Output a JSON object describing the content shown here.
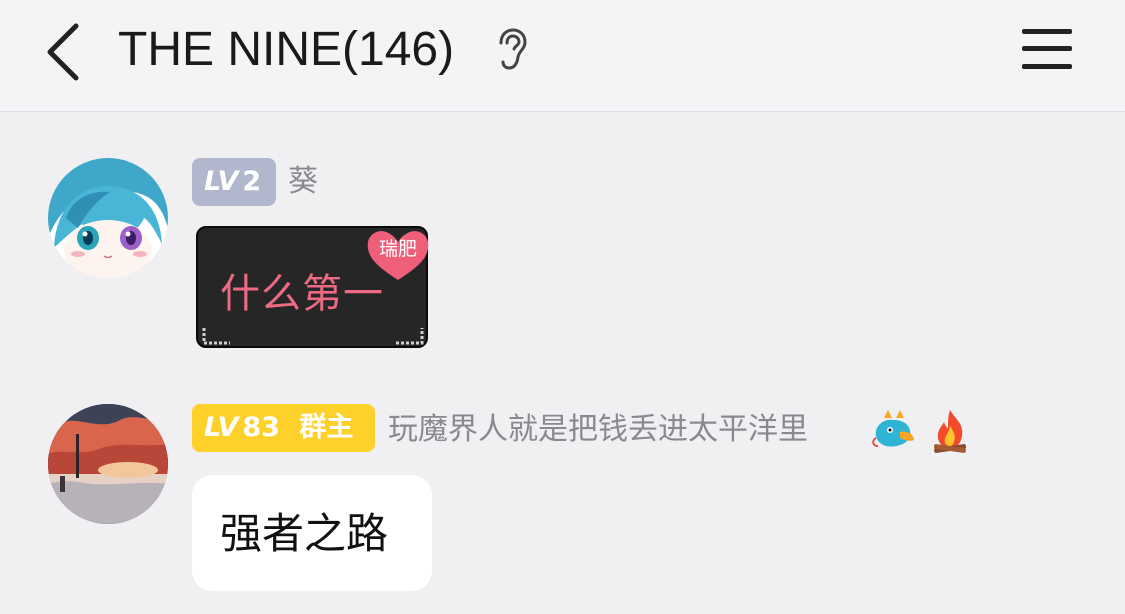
{
  "header": {
    "back_icon": "chevron-left-icon",
    "title": "THE NINE(146)",
    "ear_icon": "ear-icon",
    "menu_icon": "hamburger-menu-icon"
  },
  "messages": [
    {
      "level": "LV",
      "level_number": "2",
      "badge_color": "#b1b7cc",
      "username": "葵",
      "sticker": {
        "text": "什么第一",
        "tag": "瑞肥"
      }
    },
    {
      "level": "LV",
      "level_number": "83",
      "role": "群主",
      "badge_color": "#fdd02a",
      "username": "玩魔界人就是把钱丢进太平洋里",
      "decorations": [
        "dragon-emoji",
        "fire-emoji"
      ],
      "text": "强者之路"
    }
  ],
  "colors": {
    "background": "#f0f0f2",
    "topbar": "#f4f4f7",
    "sticker_text": "#ec6a82",
    "sticker_heart": "#ef5f79"
  }
}
